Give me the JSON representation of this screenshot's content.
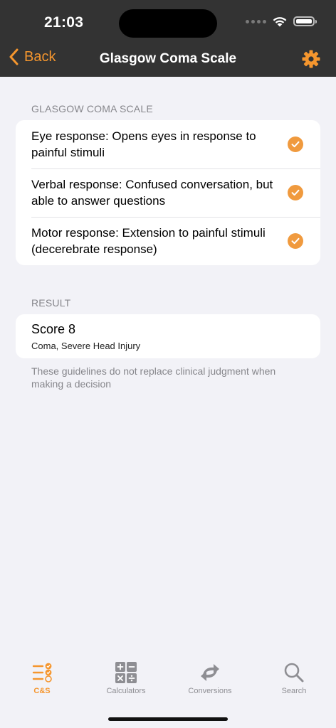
{
  "status_bar": {
    "time": "21:03"
  },
  "nav": {
    "back_label": "Back",
    "title": "Glasgow Coma Scale"
  },
  "scale_section": {
    "header": "GLASGOW COMA SCALE",
    "rows": [
      {
        "label": "Eye response: Opens eyes in response to painful stimuli",
        "checked": true
      },
      {
        "label": "Verbal response: Confused conversation, but able to answer questions",
        "checked": true
      },
      {
        "label": "Motor response: Extension to painful stimuli (decerebrate response)",
        "checked": true
      }
    ]
  },
  "result_section": {
    "header": "RESULT",
    "score": "Score 8",
    "detail": "Coma, Severe Head Injury",
    "footnote": "These guidelines do not replace clinical judgment when making a decision"
  },
  "tabs": [
    {
      "label": "C&S",
      "icon": "checklist-icon",
      "active": true
    },
    {
      "label": "Calculators",
      "icon": "calculator-icon",
      "active": false
    },
    {
      "label": "Conversions",
      "icon": "arrows-exchange-icon",
      "active": false
    },
    {
      "label": "Search",
      "icon": "search-icon",
      "active": false
    }
  ],
  "colors": {
    "accent": "#f5962e",
    "header_bg": "#333333",
    "background": "#f2f2f7"
  }
}
